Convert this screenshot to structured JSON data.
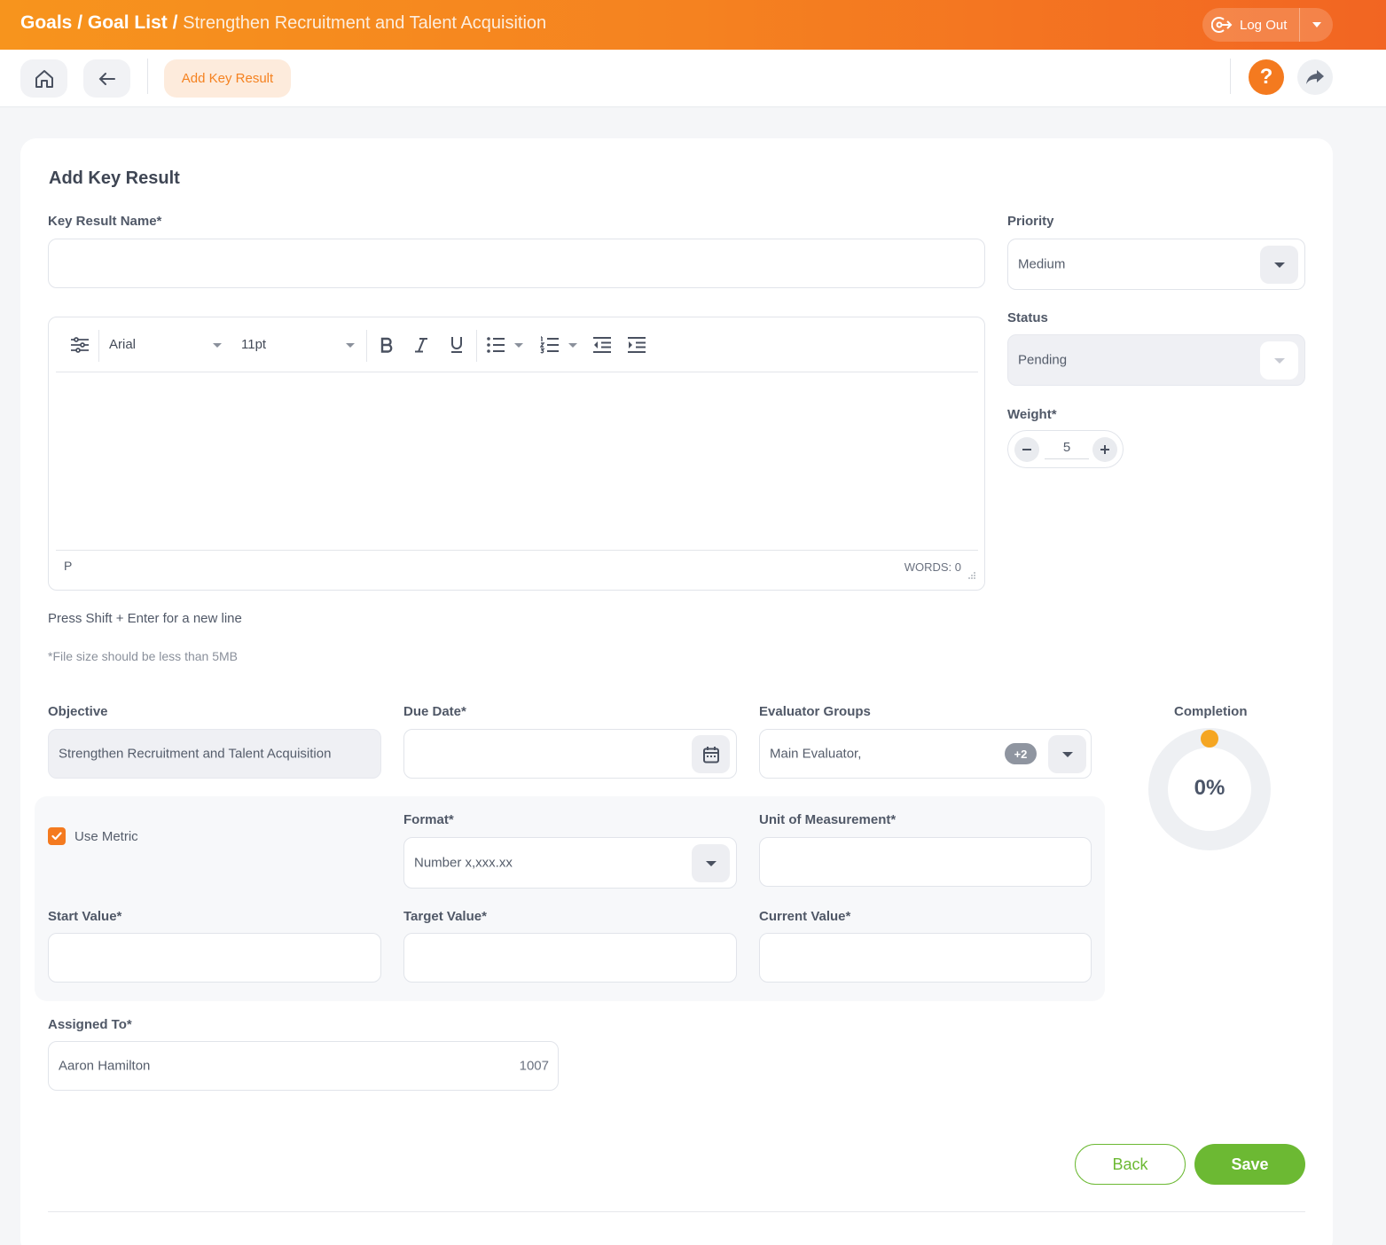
{
  "header": {
    "crumb_goals": "Goals",
    "crumb_goal_list": "Goal List",
    "crumb_current": "Strengthen Recruitment and Talent Acquisition",
    "sep": "/",
    "logout_label": "Log Out"
  },
  "toolbar": {
    "active_tab": "Add Key Result",
    "help_label": "?"
  },
  "form": {
    "title": "Add Key Result",
    "key_result_name_label": "Key Result Name*",
    "key_result_name_value": "",
    "priority_label": "Priority",
    "priority_value": "Medium",
    "status_label": "Status",
    "status_value": "Pending",
    "weight_label": "Weight*",
    "weight_value": "5",
    "editor": {
      "font": "Arial",
      "size": "11pt",
      "path": "P",
      "words": "WORDS: 0"
    },
    "note_newline": "Press Shift + Enter for a new line",
    "note_filesize": "*File size should be less than 5MB",
    "objective_label": "Objective",
    "objective_value": "Strengthen Recruitment and Talent Acquisition",
    "due_date_label": "Due Date*",
    "due_date_value": "",
    "evaluator_label": "Evaluator Groups",
    "evaluator_value": "Main Evaluator,",
    "evaluator_more": "+2",
    "completion_label": "Completion",
    "completion_value": "0%",
    "use_metric_label": "Use Metric",
    "use_metric_checked": true,
    "format_label": "Format*",
    "format_value": "Number x,xxx.xx",
    "unit_label": "Unit of Measurement*",
    "unit_value": "",
    "start_label": "Start Value*",
    "target_label": "Target Value*",
    "current_label": "Current Value*",
    "assigned_label": "Assigned To*",
    "assigned_name": "Aaron Hamilton",
    "assigned_id": "1007",
    "back_label": "Back",
    "save_label": "Save"
  },
  "colors": {
    "brand_orange": "#f58220",
    "save_green": "#6cb933",
    "completion_dot": "#f5a623"
  }
}
